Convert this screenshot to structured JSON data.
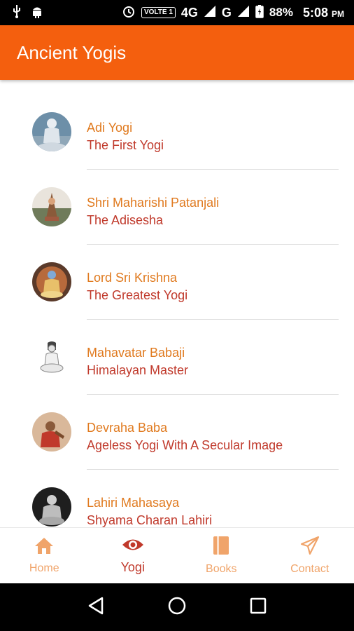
{
  "status_bar": {
    "icons_left": [
      "usb-icon",
      "android-icon"
    ],
    "volte": "VOLTE 1",
    "network": "4G",
    "network2": "G",
    "battery": "88%",
    "time": "5:08",
    "ampm": "PM"
  },
  "app_bar": {
    "title": "Ancient Yogis"
  },
  "list": [
    {
      "name": "Adi Yogi",
      "subtitle": "The First Yogi"
    },
    {
      "name": "Shri Maharishi Patanjali",
      "subtitle": "The Adisesha"
    },
    {
      "name": "Lord Sri Krishna",
      "subtitle": "The Greatest Yogi"
    },
    {
      "name": "Mahavatar Babaji",
      "subtitle": "Himalayan Master"
    },
    {
      "name": "Devraha Baba",
      "subtitle": "Ageless Yogi With A Secular Image"
    },
    {
      "name": "Lahiri Mahasaya",
      "subtitle": "Shyama Charan Lahiri"
    }
  ],
  "bottom_nav": [
    {
      "label": "Home",
      "icon": "home-icon"
    },
    {
      "label": "Yogi",
      "icon": "eye-icon",
      "active": true
    },
    {
      "label": "Books",
      "icon": "book-icon"
    },
    {
      "label": "Contact",
      "icon": "send-icon"
    }
  ],
  "colors": {
    "accent": "#f45f0e",
    "name_text": "#e07a1f",
    "subtitle_text": "#c0392b",
    "nav_inactive": "#f0a46a",
    "nav_active": "#c0392b"
  }
}
